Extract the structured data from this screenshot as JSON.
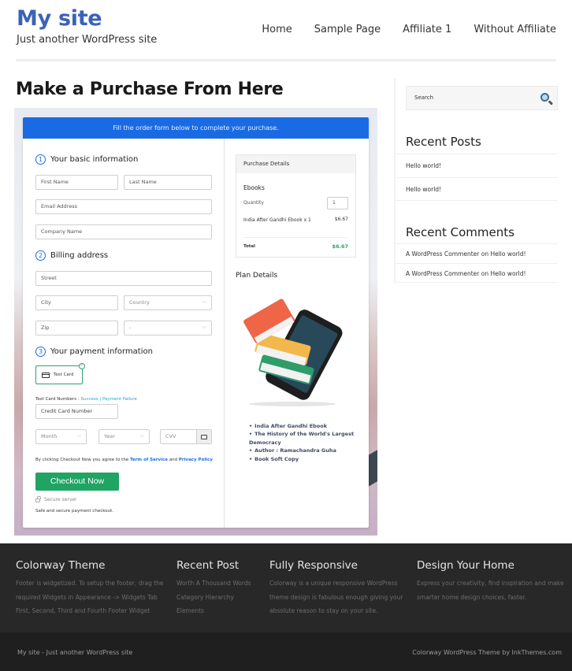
{
  "site": {
    "title": "My site",
    "tagline": "Just another WordPress site",
    "brand_color": "#3a63b8"
  },
  "nav": {
    "items": [
      {
        "label": "Home"
      },
      {
        "label": "Sample Page"
      },
      {
        "label": "Affiliate 1"
      },
      {
        "label": "Without Affiliate"
      }
    ]
  },
  "page": {
    "title": "Make a Purchase From Here"
  },
  "form": {
    "banner": "Fill the order form below to complete your purchase.",
    "banner_color": "#1a6be3",
    "steps": [
      {
        "number": "1",
        "label": "Your basic information"
      },
      {
        "number": "2",
        "label": "Billing address"
      },
      {
        "number": "3",
        "label": "Your payment information"
      }
    ],
    "fields": {
      "first_name": "First Name",
      "last_name": "Last Name",
      "email": "Email Address",
      "company": "Company Name",
      "street": "Street",
      "city": "City",
      "country": "Country",
      "zip": "Zip",
      "state": "-",
      "card_number": "Credit Card Number",
      "month": "Month",
      "year": "Year",
      "cvv": "CVV"
    },
    "payment_method": "Test Card",
    "test_numbers_label": "Test Card Numbers : ",
    "test_success": "Success",
    "test_separator": " | ",
    "test_failure": "Payment Failure",
    "agree_prefix": "By clicking Checkout Now you agree to the ",
    "terms_link": "Term of Service",
    "agree_and": " and ",
    "privacy_link": "Privacy Policy",
    "checkout_button": "Checkout Now",
    "checkout_color": "#1fa463",
    "secure_server": "Secure server",
    "safe_text": "Safe and secure payment checkout."
  },
  "purchase_details": {
    "heading": "Purchase Details",
    "category": "Ebooks",
    "quantity_label": "Quantity",
    "quantity": "1",
    "item_name": "India After Gandhi Ebook x 1",
    "item_price": "$6.67",
    "total_label": "Total",
    "total": "$6.67",
    "total_color": "#2fa36b"
  },
  "plan": {
    "heading": "Plan Details",
    "image_icon": "books-on-phone-icon",
    "features": [
      "India After Gandhi Ebook",
      "The History of the World's Largest Democracy",
      "Author : Ramachandra Guha",
      "Book Soft Copy"
    ]
  },
  "sidebar": {
    "search_placeholder": "Search",
    "recent_posts_title": "Recent Posts",
    "recent_posts": [
      "Hello world!",
      "Hello world!"
    ],
    "recent_comments_title": "Recent Comments",
    "recent_comments": [
      "A WordPress Commenter on Hello world!",
      "A WordPress Commenter on Hello world!"
    ]
  },
  "footer": {
    "columns": [
      {
        "title": "Colorway Theme",
        "text": "Footer is widgetized. To setup the footer, drag the required Widgets in Appearance -> Widgets Tab First, Second, Third and Fourth Footer Widget"
      },
      {
        "title": "Recent Post",
        "links": [
          "Worth A Thousand Words",
          "Category Hierarchy",
          "Elements"
        ]
      },
      {
        "title": "Fully Responsive",
        "text": "Colorway is a unique responsive WordPress theme design is fabulous enough giving your absolute reason to stay on your site."
      },
      {
        "title": "Design Your Home",
        "text": "Express your creativity, find inspiration and make smarter home design choices, faster."
      }
    ],
    "bottom_left": "My site - Just another WordPress site",
    "bottom_right": "Colorway WordPress Theme by InkThemes.com"
  }
}
